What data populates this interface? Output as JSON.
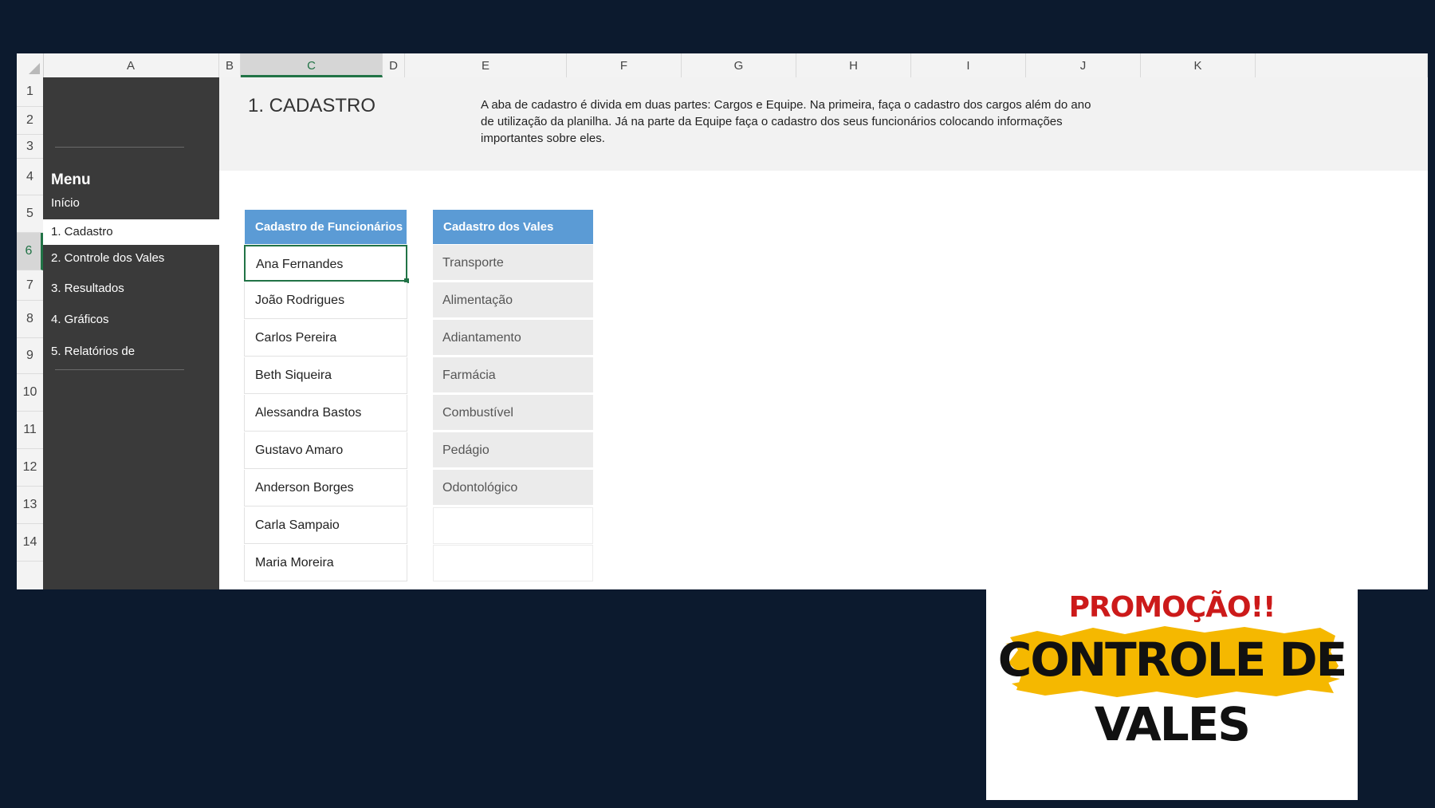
{
  "columns": [
    "A",
    "B",
    "C",
    "D",
    "E",
    "F",
    "G",
    "H",
    "I",
    "J",
    "K"
  ],
  "selected_column": "C",
  "rows": [
    "1",
    "2",
    "3",
    "4",
    "5",
    "6",
    "7",
    "8",
    "9",
    "10",
    "11",
    "12",
    "13",
    "14"
  ],
  "selected_row": "6",
  "menu": {
    "title": "Menu",
    "items": [
      {
        "label": "Início",
        "active": false
      },
      {
        "label": "1. Cadastro",
        "active": true
      },
      {
        "label": "2. Controle dos Vales",
        "active": false
      },
      {
        "label": "3. Resultados",
        "active": false
      },
      {
        "label": "4. Gráficos",
        "active": false
      },
      {
        "label": "5. Relatórios de",
        "active": false
      }
    ]
  },
  "header": {
    "title": "1. CADASTRO",
    "description": "A aba de cadastro é divida em duas partes: Cargos e Equipe. Na primeira, faça o cadastro dos cargos além do ano de utilização da planilha. Já na parte da Equipe faça o cadastro dos seus funcionários colocando informações importantes sobre eles."
  },
  "employees": {
    "header": "Cadastro de Funcionários",
    "names": [
      "Ana Fernandes",
      "João Rodrigues",
      "Carlos Pereira",
      "Beth Siqueira",
      "Alessandra Bastos",
      "Gustavo Amaro",
      "Anderson Borges",
      "Carla Sampaio",
      "Maria Moreira"
    ]
  },
  "vales": {
    "header": "Cadastro dos Vales",
    "items": [
      "Transporte",
      "Alimentação",
      "Adiantamento",
      "Farmácia",
      "Combustível",
      "Pedágio",
      "Odontológico",
      "",
      ""
    ]
  },
  "promo": {
    "subtitle": "PROMOÇÃO!!",
    "title_line1": "CONTROLE DE",
    "title_line2": "VALES"
  },
  "colors": {
    "background": "#0c1a2e",
    "menu_bg": "#3a3a3a",
    "table_header": "#5b9bd5",
    "excel_green": "#217346",
    "promo_red": "#cc1a1a",
    "promo_brush": "#f5b800"
  }
}
